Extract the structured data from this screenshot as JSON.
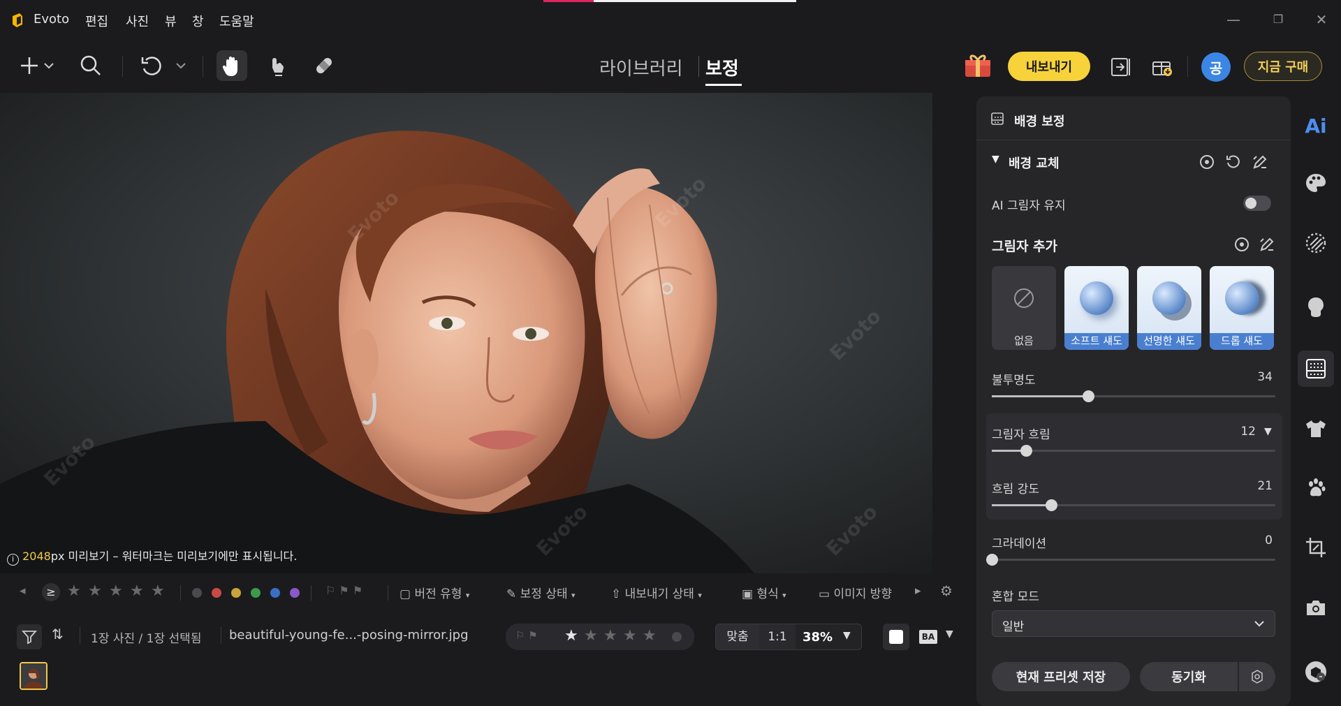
{
  "app": {
    "name": "Evoto"
  },
  "menu": [
    "편집",
    "사진",
    "뷰",
    "창",
    "도움말"
  ],
  "window": {
    "minimize": "—",
    "restore": "❐",
    "close": "✕"
  },
  "toolbar": {
    "tabs": {
      "library": "라이브러리",
      "retouch": "보정"
    },
    "export_label": "내보내기",
    "avatar_initial": "공",
    "buy_label": "지금 구매"
  },
  "canvas": {
    "preview_px": "2048",
    "preview_note": "px 미리보기 – 워터마크는 미리보기에만 표시됩니다.",
    "watermark": "Evoto"
  },
  "filterbar": {
    "version_type": "버전 유형",
    "retouch_status": "보정 상태",
    "export_status": "내보내기 상태",
    "format": "형식",
    "orientation": "이미지 방향",
    "gte": "≥",
    "colors": [
      "#4a4a4e",
      "#c94848",
      "#c9a43a",
      "#3c9a4c",
      "#3a6fc4",
      "#8a58c8"
    ]
  },
  "bottombar": {
    "count": "1장 사진 / 1장 선택됨",
    "filename": "beautiful-young-fe...-posing-mirror.jpg",
    "fit": "맞춤",
    "ratio": "1:1",
    "zoom": "38%",
    "ba": "BA"
  },
  "panel": {
    "title": "배경 보정",
    "section": "배경 교체",
    "ai_shadow": "AI 그림자 유지",
    "ai_shadow_on": false,
    "add_shadow": "그림자 추가",
    "shadow_options": [
      "없음",
      "소프트 섀도",
      "선명한 섀도",
      "드롭 섀도"
    ],
    "sliders": [
      {
        "label": "불투명도",
        "value": 34
      },
      {
        "label": "그림자 흐림",
        "value": 12
      },
      {
        "label": "흐림 강도",
        "value": 21
      },
      {
        "label": "그라데이션",
        "value": 0
      }
    ],
    "blend_mode_label": "혼합 모드",
    "blend_mode_value": "일반",
    "save_preset": "현재 프리셋 저장",
    "sync": "동기화"
  },
  "right_rail": {
    "ai_label": "Ai"
  }
}
